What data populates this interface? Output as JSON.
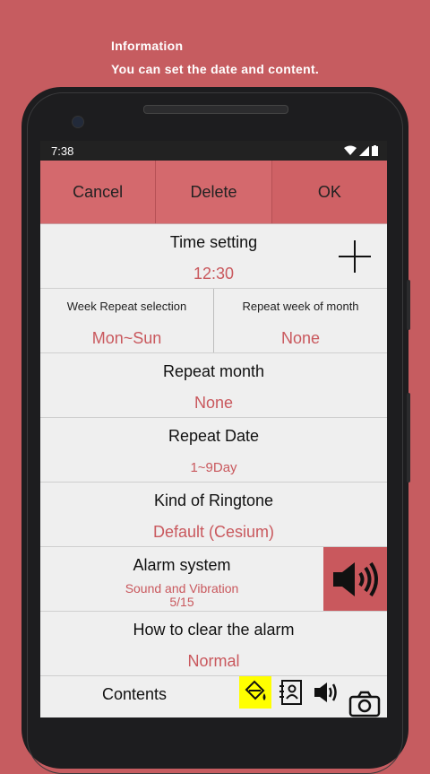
{
  "caption": {
    "line1": "Information",
    "line2": "You can set the date and content."
  },
  "status": {
    "time": "7:38"
  },
  "actions": {
    "cancel": "Cancel",
    "delete": "Delete",
    "ok": "OK"
  },
  "time_setting": {
    "title": "Time setting",
    "value": "12:30"
  },
  "week_repeat": {
    "title": "Week Repeat selection",
    "value": "Mon~Sun"
  },
  "repeat_week_of_month": {
    "title": "Repeat week of month",
    "value": "None"
  },
  "repeat_month": {
    "title": "Repeat month",
    "value": "None"
  },
  "repeat_date": {
    "title": "Repeat Date",
    "value": "1~9Day"
  },
  "ringtone": {
    "title": "Kind of Ringtone",
    "value": "Default (Cesium)"
  },
  "alarm_system": {
    "title": "Alarm system",
    "mode": "Sound and Vibration",
    "level": "5/15"
  },
  "clear_alarm": {
    "title": "How to clear the alarm",
    "value": "Normal"
  },
  "contents": {
    "title": "Contents"
  },
  "colors": {
    "background": "#c65c60",
    "accent": "#c9585d",
    "highlight": "#ffff00"
  },
  "icons": [
    "wifi-icon",
    "signal-icon",
    "battery-icon",
    "plus-icon",
    "speaker-icon",
    "paint-bucket-icon",
    "contact-card-icon",
    "volume-icon",
    "camera-icon"
  ]
}
